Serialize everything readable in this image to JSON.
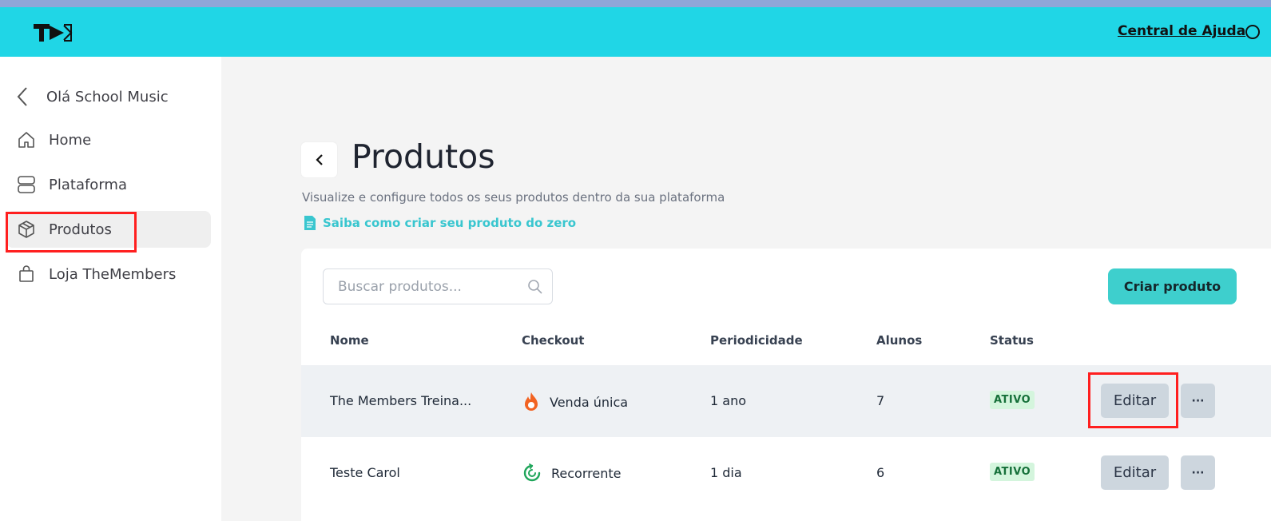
{
  "header": {
    "logo": "TM",
    "help_label": "Central de Ajuda"
  },
  "sidebar": {
    "back_label": "Olá School Music",
    "items": [
      {
        "label": "Home",
        "icon": "home-icon"
      },
      {
        "label": "Plataforma",
        "icon": "layers-icon"
      },
      {
        "label": "Produtos",
        "icon": "box-icon"
      },
      {
        "label": "Loja TheMembers",
        "icon": "shopping-bag-icon"
      }
    ]
  },
  "page": {
    "title": "Produtos",
    "subtitle": "Visualize e configure todos os seus produtos dentro da sua plataforma",
    "learn_link": "Saiba como criar seu produto do zero"
  },
  "toolbar": {
    "search_placeholder": "Buscar produtos...",
    "create_label": "Criar produto"
  },
  "table": {
    "columns": [
      "Nome",
      "Checkout",
      "Periodicidade",
      "Alunos",
      "Status"
    ],
    "rows": [
      {
        "nome": "The Members Treina...",
        "checkout": "Venda única",
        "checkout_icon": "fire-icon",
        "periodicidade": "1 ano",
        "alunos": "7",
        "status": "ATIVO",
        "edit_label": "Editar",
        "more_label": "···"
      },
      {
        "nome": "Teste Carol",
        "checkout": "Recorrente",
        "checkout_icon": "recurring-icon",
        "periodicidade": "1 dia",
        "alunos": "6",
        "status": "ATIVO",
        "edit_label": "Editar",
        "more_label": "···"
      }
    ]
  },
  "colors": {
    "header": "#20d6e6",
    "accent": "#3ecfcd",
    "highlight": "#ff1f1f",
    "active_badge_bg": "#d4f5dd"
  }
}
